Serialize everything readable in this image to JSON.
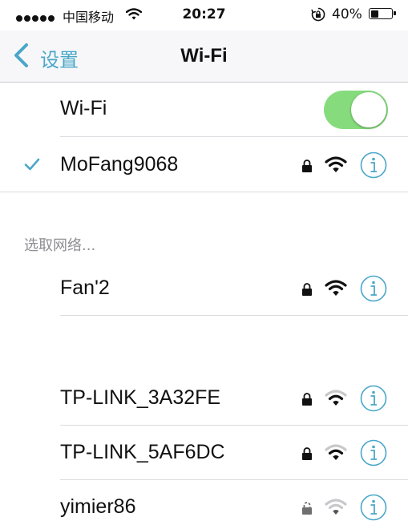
{
  "status_bar": {
    "carrier": "中国移动",
    "time": "20:27",
    "battery_percent": "40%",
    "battery_level": 0.4,
    "signal_bars": 5,
    "icons": [
      "signal-dots-icon",
      "wifi-icon",
      "rotation-lock-icon",
      "battery-icon"
    ]
  },
  "nav": {
    "back_label": "设置",
    "title": "Wi-Fi"
  },
  "wifi_toggle": {
    "label": "Wi-Fi",
    "on": true
  },
  "connected_network": {
    "name": "MoFang9068",
    "secured": true,
    "signal": 3
  },
  "section_header": "选取网络...",
  "networks": [
    {
      "name": "Fan'2",
      "secured": true,
      "signal": 3
    },
    {
      "name": "TP-LINK_3A32FE",
      "secured": true,
      "signal": 2
    },
    {
      "name": "TP-LINK_5AF6DC",
      "secured": true,
      "signal": 2
    },
    {
      "name": "yimier86",
      "secured": true,
      "signal": 1
    }
  ],
  "colors": {
    "accent": "#4aa7c8",
    "toggle_on": "#86dc7d",
    "separator": "#dcdce0",
    "section_text": "#8e8e93"
  }
}
